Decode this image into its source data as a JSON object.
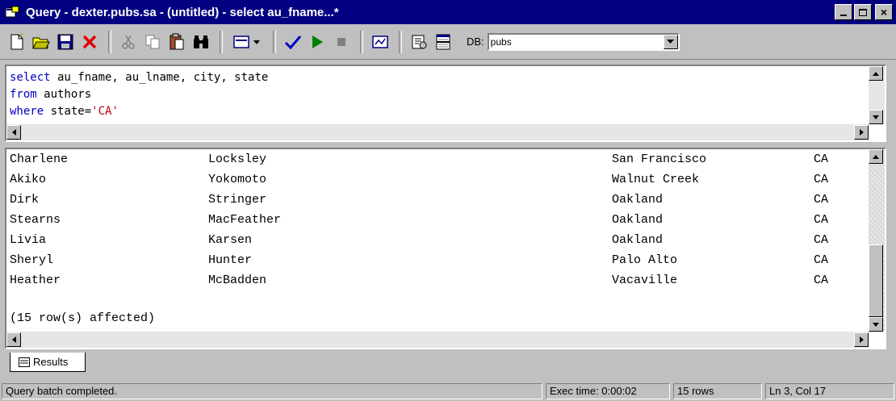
{
  "window": {
    "title": "Query - dexter.pubs.sa - (untitled) - select au_fname...*",
    "minimize_label": "_",
    "maximize_label": "□",
    "close_label": "×"
  },
  "toolbar": {
    "db_label": "DB:",
    "db_value": "pubs"
  },
  "query": {
    "lines": [
      [
        {
          "text": "select",
          "c": "kw"
        },
        {
          "text": " au_fname, au_lname, city, state",
          "c": "id"
        }
      ],
      [
        {
          "text": "from",
          "c": "kw"
        },
        {
          "text": " authors",
          "c": "id"
        }
      ],
      [
        {
          "text": "where",
          "c": "kw"
        },
        {
          "text": " state=",
          "c": "id"
        },
        {
          "text": "'CA'",
          "c": "str"
        }
      ]
    ]
  },
  "results": {
    "rows": [
      [
        "Charlene",
        "Locksley",
        "San Francisco",
        "CA"
      ],
      [
        "Akiko",
        "Yokomoto",
        "Walnut Creek",
        "CA"
      ],
      [
        "Dirk",
        "Stringer",
        "Oakland",
        "CA"
      ],
      [
        "Stearns",
        "MacFeather",
        "Oakland",
        "CA"
      ],
      [
        "Livia",
        "Karsen",
        "Oakland",
        "CA"
      ],
      [
        "Sheryl",
        "Hunter",
        "Palo Alto",
        "CA"
      ],
      [
        "Heather",
        "McBadden",
        "Vacaville",
        "CA"
      ]
    ],
    "summary": "(15 row(s) affected)"
  },
  "tabs": [
    {
      "label": "Results"
    }
  ],
  "status": {
    "message": "Query batch completed.",
    "exec_time": "Exec time: 0:00:02",
    "rows": "15 rows",
    "position": "Ln 3, Col 17"
  },
  "colors": {
    "title_bar": "#000080",
    "keyword": "#0000c0",
    "string_literal": "#c00000",
    "chrome": "#c0c0c0"
  }
}
